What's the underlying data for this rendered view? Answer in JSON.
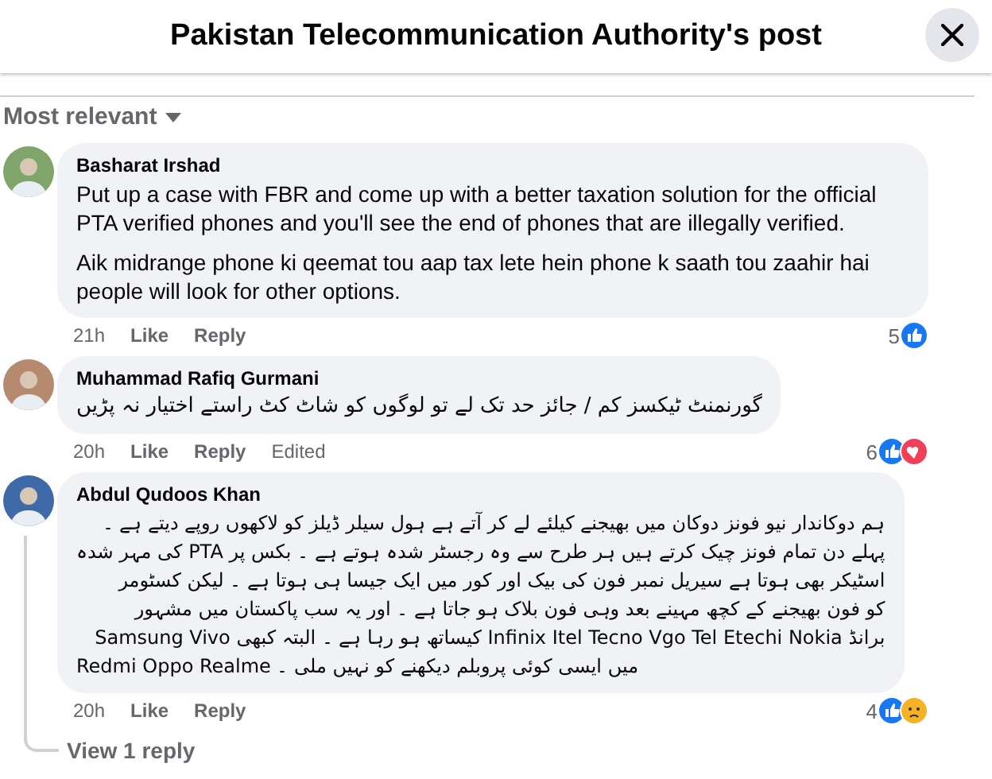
{
  "window": {
    "title": "Pakistan Telecommunication Authority's post"
  },
  "sort": {
    "label": "Most relevant"
  },
  "comments": [
    {
      "author": "Basharat Irshad",
      "paragraphs": [
        "Put up a case with FBR and come up with a better taxation solution for the official PTA verified phones and you'll see the end of phones that are illegally verified.",
        "Aik midrange phone ki qeemat tou aap tax lete hein phone k saath tou zaahir hai people will look for other options."
      ],
      "time": "21h",
      "actions": [
        "Like",
        "Reply"
      ],
      "reaction_count": "5",
      "reactions": [
        {
          "kind": "like"
        }
      ]
    },
    {
      "author": "Muhammad Rafiq Gurmani",
      "paragraphs": [
        "گورنمنٹ ٹیکسز کم / جائز حد تک لے تو لوگوں کو شاٹ کٹ راستے اختیار نہ پڑیں"
      ],
      "time": "20h",
      "actions": [
        "Like",
        "Reply",
        "Edited"
      ],
      "reaction_count": "6",
      "reactions": [
        {
          "kind": "like"
        },
        {
          "kind": "love"
        }
      ]
    },
    {
      "author": "Abdul Qudoos Khan",
      "paragraphs": [
        "ہم دوکاندار نیو فونز دوکان میں بھیجنے کیلئے لے کر آتے ہے ہول سیلر ڈیلز کو لاکھوں روپے دیتے ہے ۔",
        "پہلے دن تمام فونز چیک کرتے ہیں ہر طرح سے وہ رجسٹر شدہ ہوتے ہے ۔ بکس پر PTA کی مہر شدہ",
        "اسٹیکر بھی ہوتا ہے سیریل نمبر فون کی بیک اور کور میں ایک جیسا ہی ہوتا ہے ۔ لیکن کسٹومر",
        "کو فون بھیجنے کے کچھ مہینے بعد وہی فون بلاک ہو جاتا ہے ۔ اور یہ سب پاکستان میں مشہور",
        "برانڈ Infinix Itel Tecno Vgo Tel Etechi Nokia کیساتھ ہو رہا ہے ۔ البتہ کبھی Samsung Vivo",
        "Redmi Oppo Realme میں ایسی کوئی پروبلم دیکھنے کو نہیں ملی ۔"
      ],
      "time": "20h",
      "actions": [
        "Like",
        "Reply"
      ],
      "reaction_count": "4",
      "reactions": [
        {
          "kind": "like"
        },
        {
          "kind": "sad"
        }
      ],
      "replies_link": "View 1 reply"
    }
  ]
}
